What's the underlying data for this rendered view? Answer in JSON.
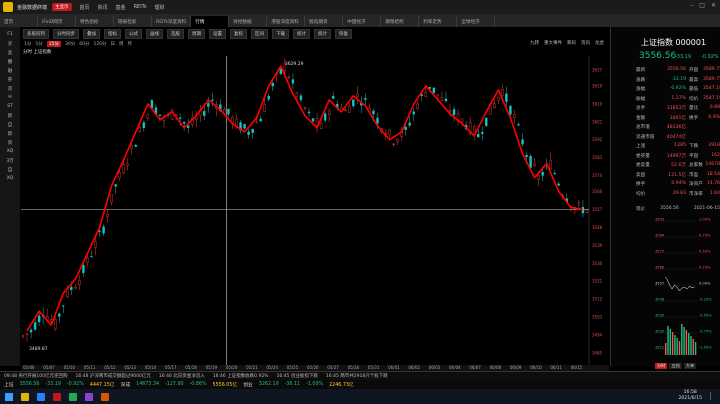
{
  "app": {
    "title": "金融数据终端",
    "badge": "主显示",
    "menu": [
      "首页",
      "资讯",
      "基金",
      "REITs",
      "理财"
    ]
  },
  "tabs": [
    "首页",
    "iFinD网页",
    "特色指标",
    "研报检索",
    "REITs深度资料",
    "行情",
    "财经数据",
    "港股深度资料",
    "股指期货",
    "中国经济",
    "期限结构",
    "利率走势",
    "全球经济"
  ],
  "active_tab_index": 5,
  "left_tools": [
    "F1",
    "买",
    "卖",
    "撤",
    "融",
    "券",
    "双",
    "H",
    "ST",
    "新",
    "自",
    "新",
    "资",
    "XQ",
    "3万",
    "自",
    "XQ"
  ],
  "chart_toolbar": [
    "多股同列",
    "分时同步",
    "叠加",
    "指标",
    "公式",
    "画线",
    "选股",
    "周期",
    "设置",
    "复权",
    "区间",
    "下载",
    "统计",
    "统计",
    "恢复"
  ],
  "periods": [
    "1分",
    "5分",
    "15分",
    "30分",
    "60分",
    "120分",
    "日",
    "周",
    "月"
  ],
  "active_period": "15分",
  "chart_caption": "分时 上证指数",
  "right_links": [
    "九转",
    "重大事件",
    "筹码",
    "资讯",
    "龙虎"
  ],
  "chart": {
    "high_label": "3629.29",
    "low_label": "3489.87",
    "y_ticks": [
      "3627",
      "3619",
      "3610",
      "3601",
      "3592",
      "3583",
      "3574",
      "3566",
      "3557",
      "3548",
      "3539",
      "3530",
      "3521",
      "3512",
      "3503",
      "3494",
      "3485"
    ],
    "x_ticks": [
      "05/06",
      "05/07",
      "05/10",
      "05/11",
      "05/12",
      "05/13",
      "05/14",
      "05/17",
      "05/18",
      "05/19",
      "05/20",
      "05/21",
      "05/24",
      "05/25",
      "05/26",
      "05/27",
      "05/28",
      "05/31",
      "06/01",
      "06/02",
      "06/03",
      "06/04",
      "06/07",
      "06/08",
      "06/09",
      "06/10",
      "06/11",
      "06/15"
    ],
    "candle_color_up": "#ff3b30",
    "candle_color_down": "#19c3c3",
    "annotation_color": "#ff0000"
  },
  "chart_data": {
    "type": "candlestick",
    "title": "上证指数 15分",
    "close_series": [
      3496,
      3506,
      3499,
      3515,
      3522,
      3535,
      3548,
      3569,
      3582,
      3596,
      3610,
      3602,
      3606,
      3598,
      3604,
      3612,
      3607,
      3600,
      3596,
      3603,
      3619,
      3629,
      3615,
      3604,
      3598,
      3612,
      3606,
      3614,
      3609,
      3599,
      3592,
      3596,
      3610,
      3619,
      3612,
      3605,
      3600,
      3594,
      3606,
      3617,
      3603,
      3585,
      3573,
      3580,
      3566,
      3558,
      3557
    ],
    "ylim": [
      3485,
      3630
    ]
  },
  "quote": {
    "name": "上证指数 000001",
    "price": "3556.56",
    "change": "-33.19",
    "pct": "-0.92%",
    "rows": [
      [
        "最新",
        "3556.56",
        "开盘",
        "3589.75"
      ],
      [
        "涨跌",
        "-33.19",
        "最高",
        "3589.75"
      ],
      [
        "涨幅",
        "-0.92%",
        "最低",
        "3547.19"
      ],
      [
        "振幅",
        "1.27%",
        "均价",
        "3547.19"
      ],
      [
        "总手",
        "31853万",
        "量比",
        "0.89"
      ],
      [
        "金额",
        "3491亿",
        "换手",
        "0.9%"
      ],
      [
        "总市值",
        "48136亿",
        "",
        ""
      ],
      [
        "流通市值",
        "40474亿",
        "",
        ""
      ],
      [
        "上涨",
        "1285",
        "下跌",
        "2918"
      ],
      [
        "委买量",
        "14997万",
        "平盘",
        "162"
      ],
      [
        "委卖量",
        "52.6万",
        "总家数",
        "14678"
      ],
      [
        "卖盘",
        "131.5亿",
        "市盈",
        "18.54"
      ],
      [
        "换手",
        "0.94%",
        "净资产",
        "14.76"
      ],
      [
        "均价",
        "29.83",
        "市净率",
        "1.60"
      ]
    ],
    "date_label": "2021-06-15",
    "date_prefix": "现价",
    "date_price": "3556.56",
    "mini_ticks": [
      "3593",
      "3584",
      "3575",
      "3566",
      "3557",
      "3548",
      "3539",
      "3530",
      "3521"
    ],
    "mini_pct": [
      "1.00%",
      "0.75%",
      "0.50%",
      "0.25%",
      "0.00%",
      "-0.25%",
      "-0.50%",
      "-0.75%",
      "-1.00%"
    ],
    "mini_tabs": [
      "分时",
      "五档",
      "大单"
    ]
  },
  "news_strip": [
    "09:48 央行开展100亿元逆回购",
    "16:48 沪深两市成交额超过9000亿元",
    "16:46 北向资金净流入",
    "16:46 上证指数收跌0.92%",
    "16:45 创业板指下跌",
    "16:45 两市共2918只个股下跌"
  ],
  "index_strip": [
    {
      "name": "上证",
      "value": "3556.56",
      "change": "-33.19",
      "pct": "-0.92%",
      "amount": "4447.15亿"
    },
    {
      "name": "深成",
      "value": "14673.34",
      "change": "-127.90",
      "pct": "-0.86%",
      "amount": "5556.05亿"
    },
    {
      "name": "创业",
      "value": "3262.19",
      "change": "-36.11",
      "pct": "-1.09%",
      "amount": "2246.73亿"
    }
  ],
  "taskbar": {
    "time": "16:58",
    "date": "2021/6/15"
  }
}
